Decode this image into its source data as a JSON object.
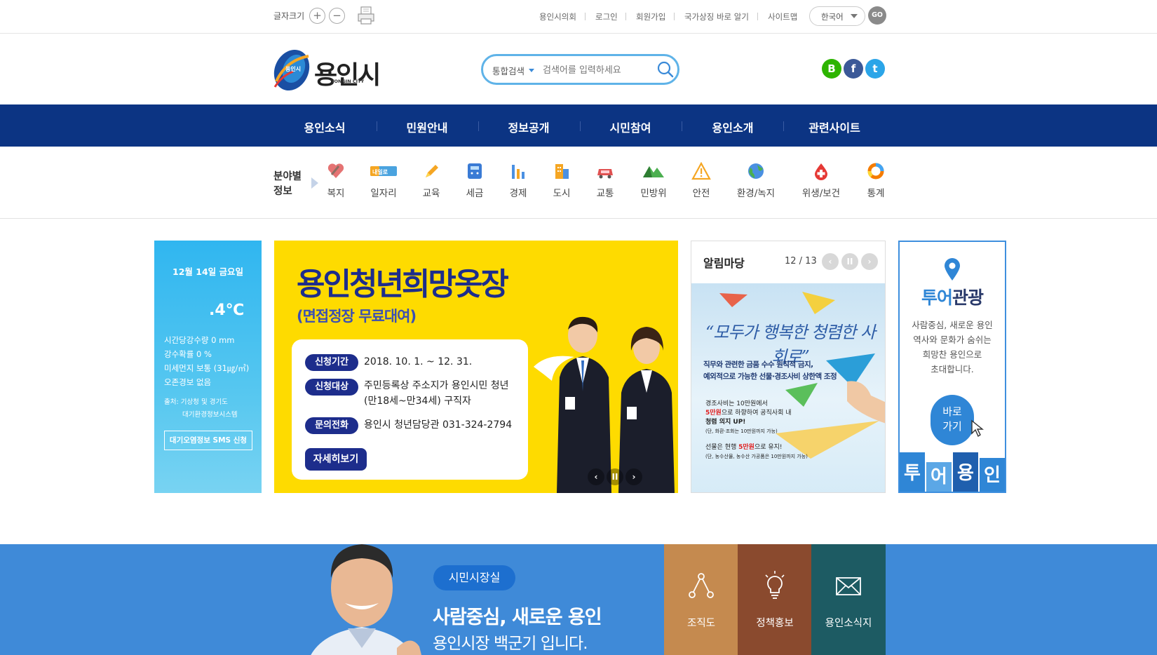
{
  "topbar": {
    "font_size_label": "글자크기",
    "zoom_in": "+",
    "zoom_out": "−",
    "links": [
      "용인시의회",
      "로그인",
      "회원가입",
      "국가상징 바로 알기",
      "사이트맵"
    ],
    "language": "한국어",
    "go_label": "GO"
  },
  "header": {
    "logo_title": "용인시",
    "logo_subtitle": "YONGIN CITY",
    "logo_emblem": "용인시",
    "search_scope": "통합검색",
    "search_placeholder": "검색어를 입력하세요",
    "sns": [
      "blog",
      "facebook",
      "twitter"
    ]
  },
  "gnb": [
    "용인소식",
    "민원안내",
    "정보공개",
    "시민참여",
    "용인소개",
    "관련사이트"
  ],
  "categories": {
    "title_line1": "분야별",
    "title_line2": "정보",
    "items": [
      {
        "label": "복지",
        "icon": "welfare-heart-icon",
        "color": "#e57373"
      },
      {
        "label": "일자리",
        "icon": "jobs-icon",
        "color": "#4aa3df",
        "badge": "내일로"
      },
      {
        "label": "교육",
        "icon": "education-pencil-icon",
        "color": "#f5a623"
      },
      {
        "label": "세금",
        "icon": "tax-calculator-icon",
        "color": "#3a7bd5"
      },
      {
        "label": "경제",
        "icon": "economy-chart-icon",
        "color": "#4a90e2"
      },
      {
        "label": "도시",
        "icon": "city-building-icon",
        "color": "#f5a623"
      },
      {
        "label": "교통",
        "icon": "traffic-car-icon",
        "color": "#e15252"
      },
      {
        "label": "민방위",
        "icon": "civil-defense-mountain-icon",
        "color": "#4caf50"
      },
      {
        "label": "안전",
        "icon": "safety-warning-icon",
        "color": "#f5a623"
      },
      {
        "label": "환경/녹지",
        "icon": "environment-globe-icon",
        "color": "#4caf50"
      },
      {
        "label": "위생/보건",
        "icon": "health-drop-icon",
        "color": "#e53935"
      },
      {
        "label": "통계",
        "icon": "statistics-donut-icon",
        "color": "#f57c00"
      }
    ]
  },
  "weather": {
    "date": "12월 14일 금요일",
    "temperature": ".4℃",
    "lines": [
      "시간당강수량 0 mm",
      "강수확률 0 %",
      "미세먼지 보통 (31㎍/㎥)",
      "오존경보 없음"
    ],
    "source_line1": "출처: 기상청 및 경기도",
    "source_line2": "대기환경정보시스템",
    "sms_button": "대기오염정보 SMS 신청"
  },
  "banner": {
    "title": "용인청년희망옷장",
    "subtitle": "(면접정장 무료대여)",
    "rows": [
      {
        "tag": "신청기간",
        "value": "2018. 10. 1. ~ 12. 31."
      },
      {
        "tag": "신청대상",
        "value": "주민등록상 주소지가 용인시민 청년",
        "value2": "(만18세~만34세) 구직자"
      },
      {
        "tag": "문의전화",
        "value": "용인시 청년담당관 031-324-2794"
      }
    ],
    "more_button": "자세히보기",
    "controls": [
      "‹",
      "II",
      "›"
    ]
  },
  "notice": {
    "title": "알림마당",
    "counter": "12 / 13",
    "slogan": "“모두가 행복한 청렴한 사회로”",
    "text_line1": "직무와 관련한 금품 수수 원칙적 금지,",
    "text_line2": "예외적으로 가능한 선물·경조사비 상한액 조정",
    "item1_line1": "경조사비는 10만원에서",
    "item1_highlight": "5만원",
    "item1_line2": "으로 하향하여 공직사회 내",
    "item1_line3": "청렴 의지 UP!",
    "item1_note": "(단, 화환·조화는 10만원까지 가능)",
    "item2_pre": "선물은 현행 ",
    "item2_highlight": "5만원",
    "item2_post": "으로 유지!",
    "item2_note": "(단, 농수산물, 농수산 가공품은 10만원까지 가능)"
  },
  "tour": {
    "title_highlight": "투어",
    "title_rest": "관광",
    "desc_lines": [
      "사람중심, 새로운 용인",
      "역사와 문화가 숨쉬는",
      "희망찬 용인으로",
      "초대합니다."
    ],
    "button_line1": "바로",
    "button_line2": "가기",
    "blocks": [
      "투",
      "어",
      "용",
      "인"
    ]
  },
  "mayor": {
    "badge": "시민시장실",
    "slogan": "사람중심, 새로운 용인",
    "name_line": "용인시장 백군기 입니다.",
    "tiles": [
      {
        "label": "조직도",
        "color": "#c58a4f"
      },
      {
        "label": "정책홍보",
        "color": "#8a4a2e"
      },
      {
        "label": "용인소식지",
        "color": "#1d5b63"
      }
    ]
  },
  "colors": {
    "gnb": "#0c3483",
    "accent": "#2f86d6",
    "banner_yellow": "#fedb00",
    "banner_navy": "#1d2d8c"
  }
}
